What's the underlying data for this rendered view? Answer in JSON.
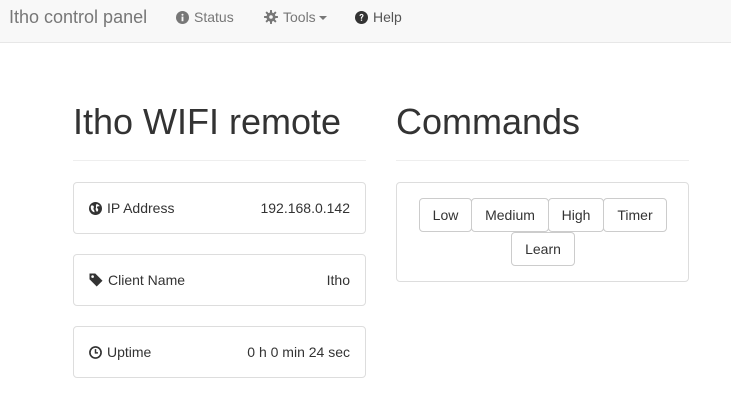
{
  "navbar": {
    "brand": "Itho control panel",
    "items": [
      {
        "label": "Status",
        "icon": "info-circle-icon"
      },
      {
        "label": "Tools",
        "icon": "gear-icon",
        "dropdown": true
      },
      {
        "label": "Help",
        "icon": "question-circle-icon"
      }
    ]
  },
  "left": {
    "title": "Itho WIFI remote",
    "panels": [
      {
        "label": "IP Address",
        "value": "192.168.0.142",
        "icon": "globe-icon"
      },
      {
        "label": "Client Name",
        "value": "Itho",
        "icon": "tag-icon"
      },
      {
        "label": "Uptime",
        "value": "0 h 0 min 24 sec",
        "icon": "clock-icon"
      }
    ]
  },
  "right": {
    "title": "Commands",
    "buttons": [
      "Low",
      "Medium",
      "High",
      "Timer",
      "Learn"
    ]
  },
  "colors": {
    "navbar_bg": "#f8f8f8",
    "nav_text": "#777777",
    "border": "#dddddd",
    "text": "#333333"
  }
}
